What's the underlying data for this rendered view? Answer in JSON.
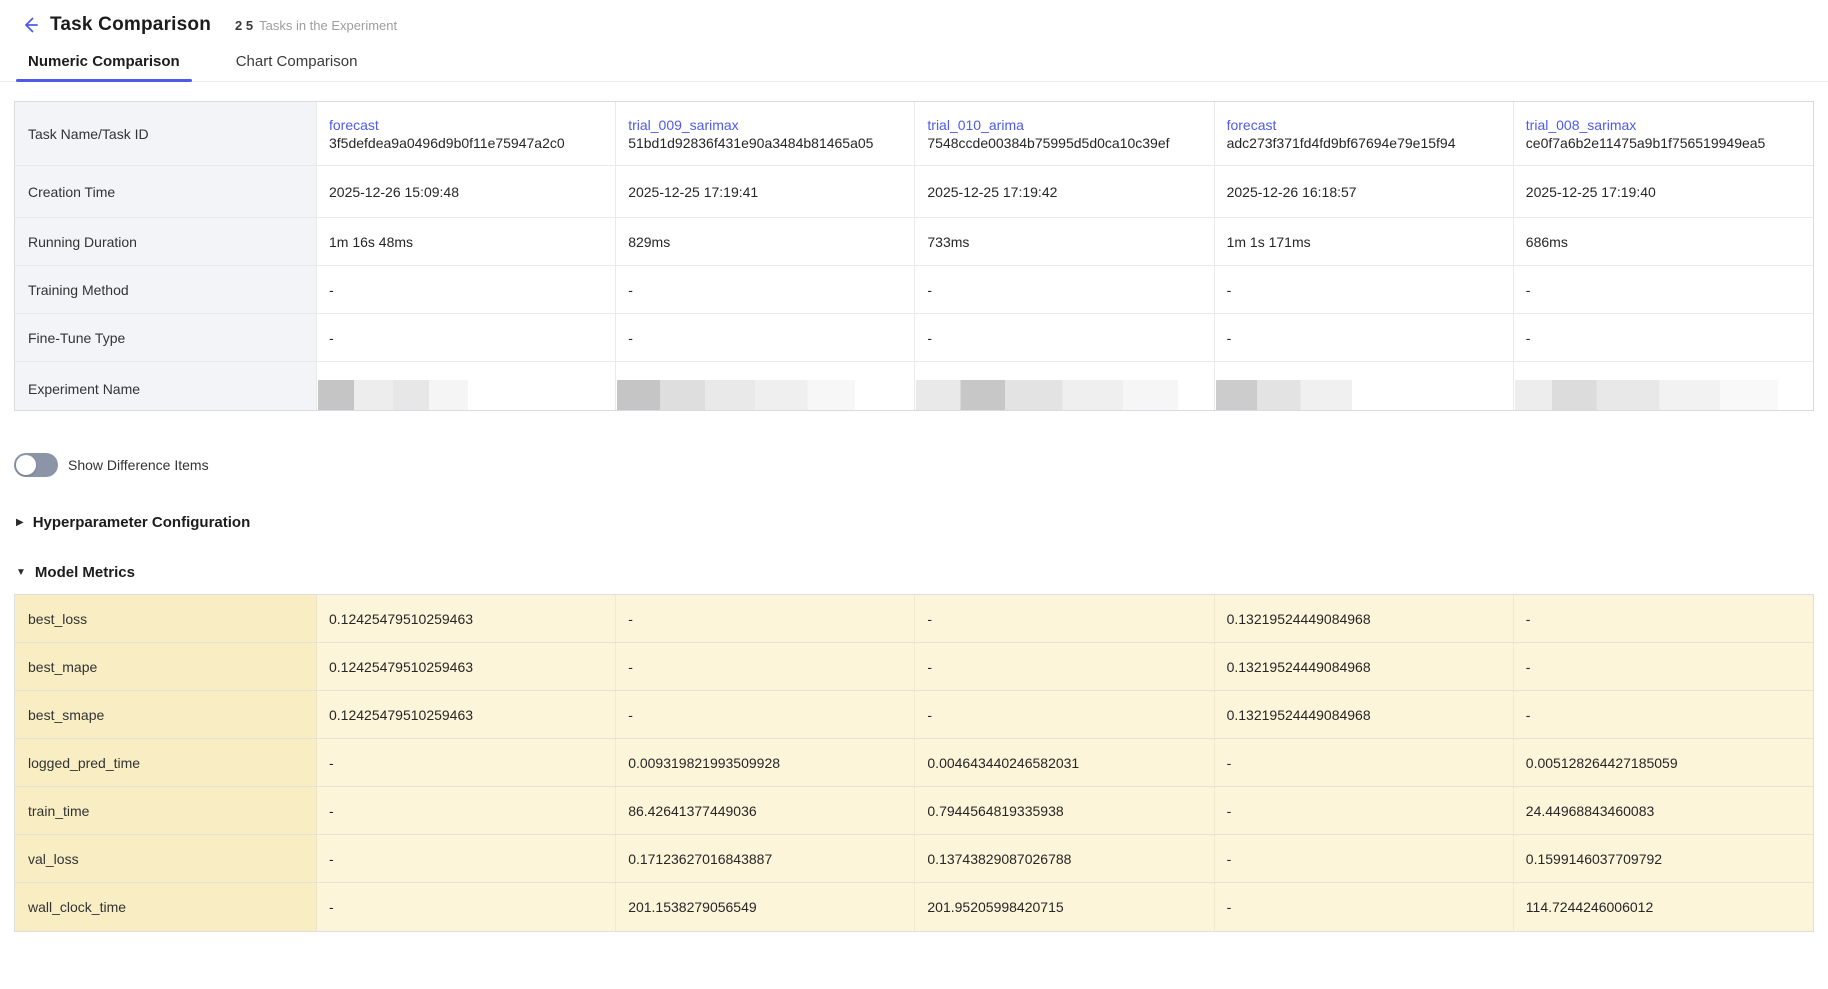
{
  "colors": {
    "accent": "#4e5be7",
    "label_col_bg": "#f3f4f7",
    "metrics_label_bg": "#f8edc3",
    "metrics_cell_bg": "#fcf5da",
    "toggle_off_track": "#8c95a8"
  },
  "header": {
    "back_icon": "arrow-left",
    "title": "Task Comparison",
    "count": "2 5",
    "count_suffix": "Tasks in the Experiment"
  },
  "tabs": [
    {
      "label": "Numeric Comparison",
      "active": true
    },
    {
      "label": "Chart Comparison",
      "active": false
    }
  ],
  "info_table": {
    "rows": [
      {
        "type": "task",
        "label": "Task Name/Task ID",
        "tasks": [
          {
            "name": "forecast",
            "id": "3f5defdea9a0496d9b0f11e75947a2c0"
          },
          {
            "name": "trial_009_sarimax",
            "id": "51bd1d92836f431e90a3484b81465a05"
          },
          {
            "name": "trial_010_arima",
            "id": "7548ccde00384b75995d5d0ca10c39ef"
          },
          {
            "name": "forecast",
            "id": "adc273f371fd4fd9bf67694e79e15f94"
          },
          {
            "name": "trial_008_sarimax",
            "id": "ce0f7a6b2e11475a9b1f756519949ea5"
          }
        ]
      },
      {
        "type": "plain",
        "tall": true,
        "label": "Creation Time",
        "values": [
          "2025-12-26 15:09:48",
          "2025-12-25 17:19:41",
          "2025-12-25 17:19:42",
          "2025-12-26 16:18:57",
          "2025-12-25 17:19:40"
        ]
      },
      {
        "type": "plain",
        "label": "Running Duration",
        "values": [
          "1m 16s 48ms",
          "829ms",
          "733ms",
          "1m 1s 171ms",
          "686ms"
        ]
      },
      {
        "type": "plain",
        "label": "Training Method",
        "values": [
          "-",
          "-",
          "-",
          "-",
          "-"
        ]
      },
      {
        "type": "plain",
        "label": "Fine-Tune Type",
        "values": [
          "-",
          "-",
          "-",
          "-",
          "-"
        ]
      },
      {
        "type": "loading",
        "label": "Experiment Name"
      }
    ]
  },
  "toggle": {
    "label": "Show Difference Items",
    "state": "off"
  },
  "sections": [
    {
      "label": "Hyperparameter Configuration",
      "collapsed": true,
      "icon": "caret-right",
      "glyph": "▶"
    },
    {
      "label": "Model Metrics",
      "collapsed": false,
      "icon": "caret-down",
      "glyph": "▼"
    }
  ],
  "metrics_table": {
    "rows": [
      {
        "label": "best_loss",
        "values": [
          "0.12425479510259463",
          "-",
          "-",
          "0.13219524449084968",
          "-"
        ]
      },
      {
        "label": "best_mape",
        "values": [
          "0.12425479510259463",
          "-",
          "-",
          "0.13219524449084968",
          "-"
        ]
      },
      {
        "label": "best_smape",
        "values": [
          "0.12425479510259463",
          "-",
          "-",
          "0.13219524449084968",
          "-"
        ]
      },
      {
        "label": "logged_pred_time",
        "values": [
          "-",
          "0.009319821993509928",
          "0.004643440246582031",
          "-",
          "0.005128264427185059"
        ]
      },
      {
        "label": "train_time",
        "values": [
          "-",
          "86.42641377449036",
          "0.7944564819335938",
          "-",
          "24.44968843460083"
        ]
      },
      {
        "label": "val_loss",
        "values": [
          "-",
          "0.17123627016843887",
          "0.13743829087026788",
          "-",
          "0.1599146037709792"
        ]
      },
      {
        "label": "wall_clock_time",
        "values": [
          "-",
          "201.1538279056549",
          "201.95205998420715",
          "-",
          "114.7244246006012"
        ]
      }
    ]
  }
}
